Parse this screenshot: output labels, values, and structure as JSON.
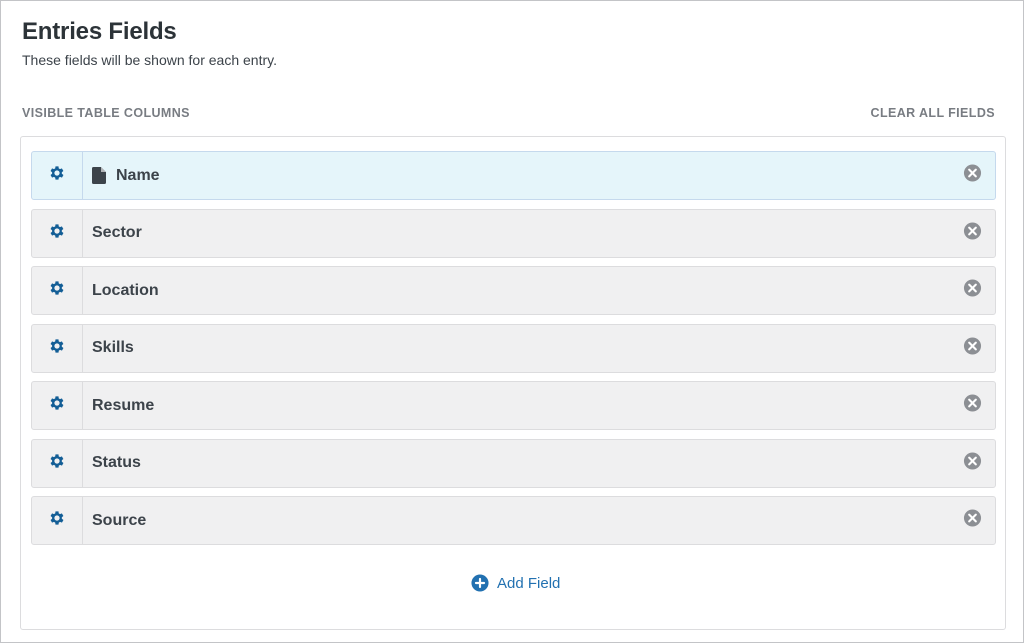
{
  "header": {
    "title": "Entries Fields",
    "subtitle": "These fields will be shown for each entry."
  },
  "section": {
    "label": "VISIBLE TABLE COLUMNS",
    "clear_all_label": "CLEAR ALL FIELDS"
  },
  "fields": [
    {
      "label": "Name",
      "icon": "document-icon",
      "active": true
    },
    {
      "label": "Sector"
    },
    {
      "label": "Location"
    },
    {
      "label": "Skills"
    },
    {
      "label": "Resume"
    },
    {
      "label": "Status"
    },
    {
      "label": "Source"
    }
  ],
  "add_field": {
    "label": "Add Field",
    "icon": "plus-circle-icon"
  },
  "colors": {
    "accent": "#2271b1",
    "gear": "#135e96",
    "remove": "#8c8f94",
    "active_row": "#e5f5fa",
    "row": "#f0f0f1"
  }
}
